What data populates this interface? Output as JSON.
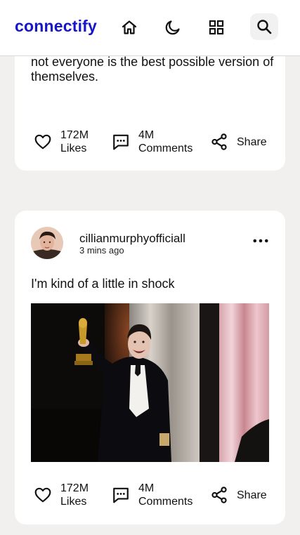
{
  "header": {
    "brand": "connectify",
    "icons": [
      "home-icon",
      "moon-icon",
      "grid-icon",
      "search-icon"
    ]
  },
  "posts": [
    {
      "text": "not everyone is the best possible version of themselves.",
      "likes_count": "172M",
      "likes_label": "Likes",
      "comments_count": "4M",
      "comments_label": "Comments",
      "share_label": "Share"
    },
    {
      "username": "cillianmurphyofficiall",
      "time": "3 mins ago",
      "text": "I'm kind of a little in shock",
      "likes_count": "172M",
      "likes_label": "Likes",
      "comments_count": "4M",
      "comments_label": "Comments",
      "share_label": "Share"
    }
  ],
  "colors": {
    "brand": "#1515c9",
    "background": "#f1f0ef"
  }
}
